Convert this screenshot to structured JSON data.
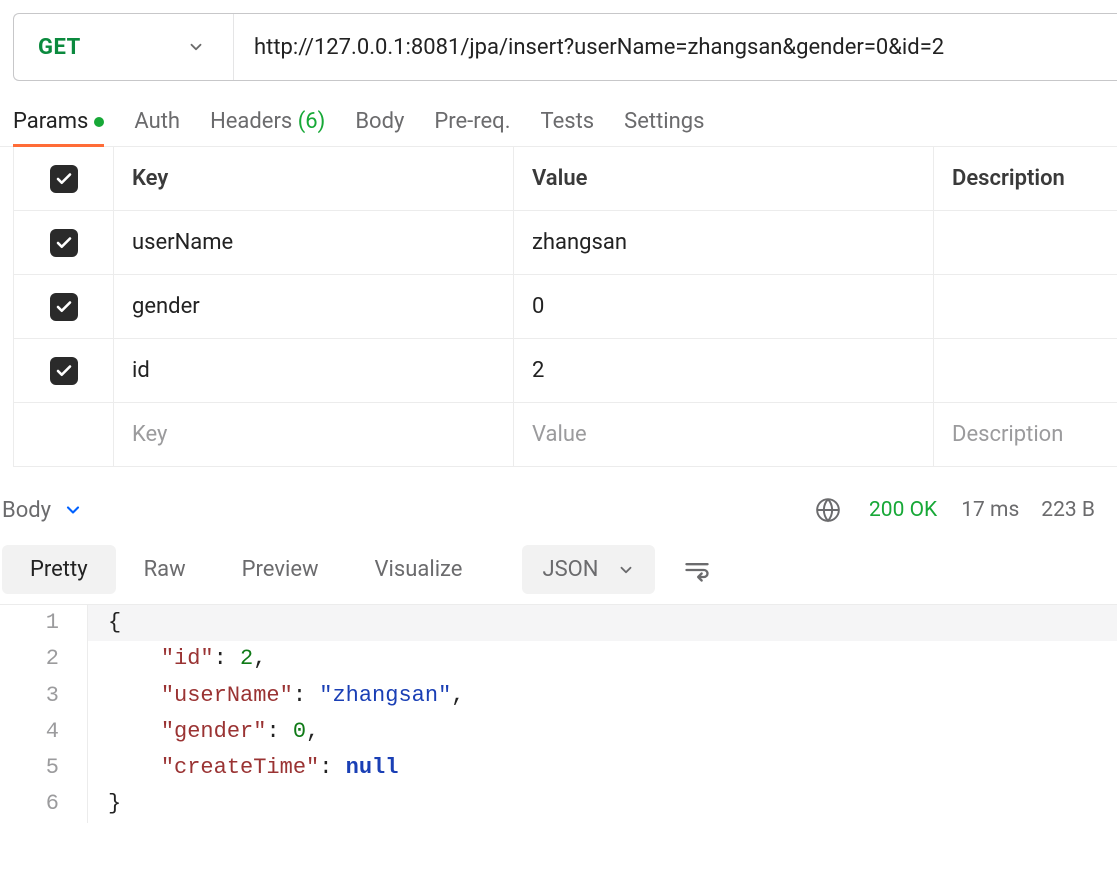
{
  "request": {
    "method": "GET",
    "url": "http://127.0.0.1:8081/jpa/insert?userName=zhangsan&gender=0&id=2"
  },
  "tabs": {
    "params": "Params",
    "auth": "Auth",
    "headers": "Headers",
    "headers_count": "(6)",
    "body": "Body",
    "prereq": "Pre-req.",
    "tests": "Tests",
    "settings": "Settings"
  },
  "params_table": {
    "header": {
      "key": "Key",
      "value": "Value",
      "description": "Description"
    },
    "rows": [
      {
        "checked": true,
        "key": "userName",
        "value": "zhangsan",
        "description": ""
      },
      {
        "checked": true,
        "key": "gender",
        "value": "0",
        "description": ""
      },
      {
        "checked": true,
        "key": "id",
        "value": "2",
        "description": ""
      }
    ],
    "new_row_placeholder": {
      "key": "Key",
      "value": "Value",
      "description": "Description"
    }
  },
  "response": {
    "section_label": "Body",
    "status": "200 OK",
    "time": "17 ms",
    "size": "223 B",
    "view_tabs": {
      "pretty": "Pretty",
      "raw": "Raw",
      "preview": "Preview",
      "visualize": "Visualize"
    },
    "format": "JSON",
    "body_lines": [
      {
        "n": "1",
        "tokens": [
          {
            "t": "brace",
            "v": "{"
          }
        ]
      },
      {
        "n": "2",
        "tokens": [
          {
            "t": "indent",
            "v": "    "
          },
          {
            "t": "key",
            "v": "\"id\""
          },
          {
            "t": "punct",
            "v": ": "
          },
          {
            "t": "num",
            "v": "2"
          },
          {
            "t": "punct",
            "v": ","
          }
        ]
      },
      {
        "n": "3",
        "tokens": [
          {
            "t": "indent",
            "v": "    "
          },
          {
            "t": "key",
            "v": "\"userName\""
          },
          {
            "t": "punct",
            "v": ": "
          },
          {
            "t": "str",
            "v": "\"zhangsan\""
          },
          {
            "t": "punct",
            "v": ","
          }
        ]
      },
      {
        "n": "4",
        "tokens": [
          {
            "t": "indent",
            "v": "    "
          },
          {
            "t": "key",
            "v": "\"gender\""
          },
          {
            "t": "punct",
            "v": ": "
          },
          {
            "t": "num",
            "v": "0"
          },
          {
            "t": "punct",
            "v": ","
          }
        ]
      },
      {
        "n": "5",
        "tokens": [
          {
            "t": "indent",
            "v": "    "
          },
          {
            "t": "key",
            "v": "\"createTime\""
          },
          {
            "t": "punct",
            "v": ": "
          },
          {
            "t": "null",
            "v": "null"
          }
        ]
      },
      {
        "n": "6",
        "tokens": [
          {
            "t": "brace",
            "v": "}"
          }
        ]
      }
    ]
  }
}
